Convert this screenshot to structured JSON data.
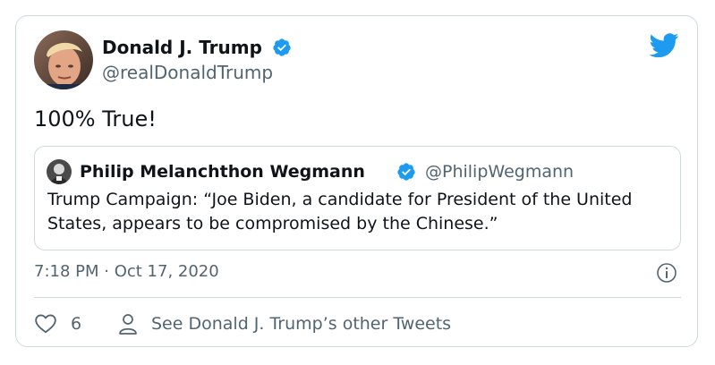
{
  "tweet": {
    "author_name": "Donald J. Trump",
    "author_handle": "@realDonaldTrump",
    "text": "100% True!",
    "timestamp": "7:18 PM · Oct 17, 2020",
    "like_count": "6",
    "other_tweets_link": "See Donald J. Trump’s other Tweets"
  },
  "quoted_tweet": {
    "author_name": "Philip Melanchthon Wegmann",
    "author_handle": "@PhilipWegmann",
    "text": "Trump Campaign: “Joe Biden, a candidate for President of the United States, appears to be compromised by the Chinese.”"
  },
  "icons": {
    "brand": "twitter-bird-icon",
    "verified": "verified-badge-icon",
    "info": "info-icon",
    "like": "heart-icon",
    "profile": "person-icon"
  },
  "colors": {
    "brand_blue": "#1d9bf0",
    "text_primary": "#0f1419",
    "text_secondary": "#536471",
    "border": "#cfd9de"
  }
}
